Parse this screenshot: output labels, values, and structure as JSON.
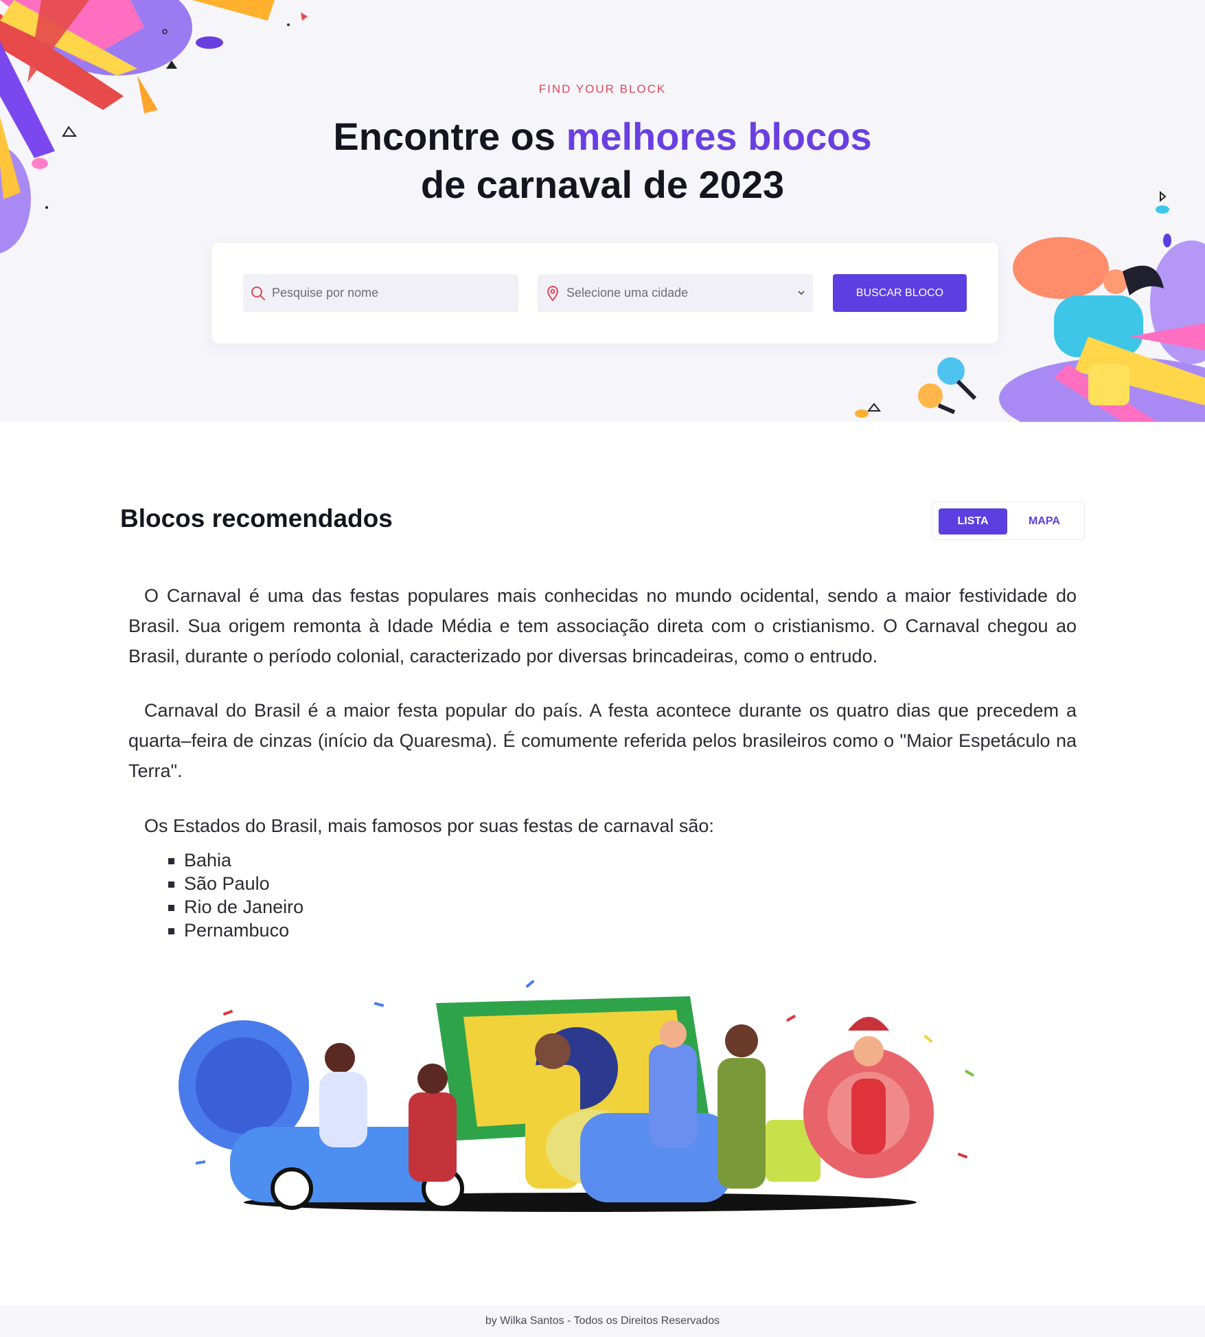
{
  "hero": {
    "eyebrow": "FIND YOUR BLOCK",
    "title_part1": "Encontre os ",
    "title_accent": "melhores blocos",
    "title_part2": "de carnaval de 2023",
    "accent_color": "#6a3fe0"
  },
  "search": {
    "name_placeholder": "Pesquise por nome",
    "city_placeholder": "Selecione uma cidade",
    "button_label": "BUSCAR BLOCO",
    "search_icon": "search-icon",
    "location_icon": "map-pin-icon",
    "chevron_icon": "chevron-down-icon"
  },
  "recommended": {
    "title": "Blocos recomendados",
    "toggle": {
      "lista": "LISTA",
      "mapa": "MAPA",
      "selected": "LISTA"
    },
    "paragraph1": "O Carnaval é uma das festas populares mais conhecidas no mundo ocidental, sendo a maior festividade do Brasil. Sua origem remonta à Idade Média e tem associação direta com o cristianismo. O Carnaval chegou ao Brasil, durante o período colonial, caracterizado por diversas brincadeiras, como o entrudo.",
    "paragraph2": "Carnaval do Brasil é a maior festa popular do país. A festa acontece durante os quatro dias que precedem a quarta–feira de cinzas (início da Quaresma). É comumente referida pelos brasileiros como o \"Maior Espetáculo na Terra\".",
    "paragraph3": "Os Estados do Brasil, mais famosos por suas festas de carnaval são:",
    "states": [
      "Bahia",
      "São Paulo",
      "Rio de Janeiro",
      "Pernambuco"
    ]
  },
  "footer": {
    "text": "by Wilka Santos - Todos os Direitos Reservados"
  },
  "colors": {
    "primary": "#5b3fe0",
    "eyebrow": "#e0485a",
    "hero_bg": "#f6f5fa"
  }
}
